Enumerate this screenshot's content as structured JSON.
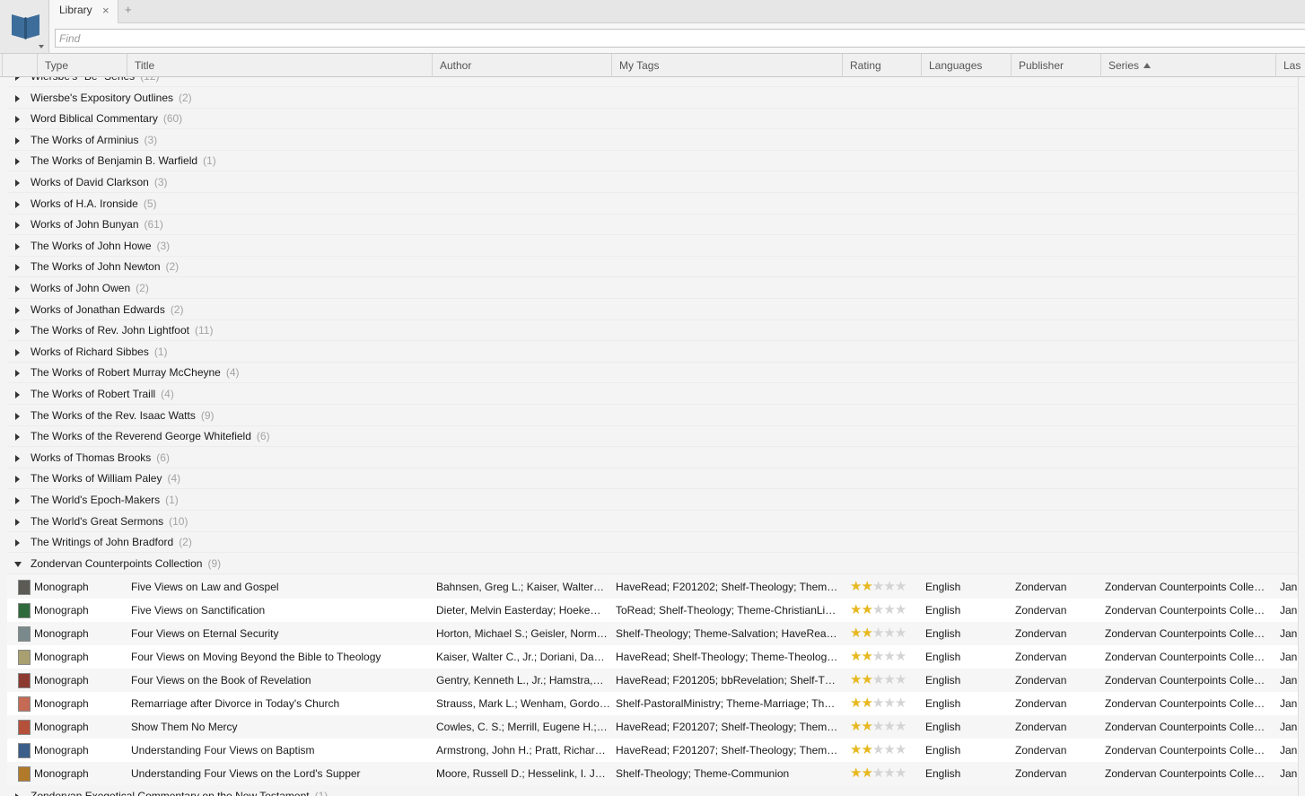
{
  "app": {
    "logo_icon": "library-book-icon",
    "tab_label": "Library",
    "tab_close": "×",
    "new_tab": "+",
    "find_placeholder": "Find"
  },
  "columns": [
    {
      "key": "type",
      "label": "Type"
    },
    {
      "key": "title",
      "label": "Title"
    },
    {
      "key": "author",
      "label": "Author"
    },
    {
      "key": "tags",
      "label": "My Tags"
    },
    {
      "key": "rating",
      "label": "Rating"
    },
    {
      "key": "languages",
      "label": "Languages"
    },
    {
      "key": "publisher",
      "label": "Publisher"
    },
    {
      "key": "series",
      "label": "Series"
    },
    {
      "key": "last",
      "label": "Las"
    }
  ],
  "sort": {
    "column": "series",
    "direction": "ascending"
  },
  "groups": [
    {
      "name": "Wiersbe's \"Be\" Series",
      "count": "(12)"
    },
    {
      "name": "Wiersbe's Expository Outlines",
      "count": "(2)"
    },
    {
      "name": "Word Biblical Commentary",
      "count": "(60)"
    },
    {
      "name": "The Works of Arminius",
      "count": "(3)"
    },
    {
      "name": "The Works of Benjamin B. Warfield",
      "count": "(1)"
    },
    {
      "name": "Works of David Clarkson",
      "count": "(3)"
    },
    {
      "name": "Works of H.A. Ironside",
      "count": "(5)"
    },
    {
      "name": "Works of John Bunyan",
      "count": "(61)"
    },
    {
      "name": "The Works of John Howe",
      "count": "(3)"
    },
    {
      "name": "The Works of John Newton",
      "count": "(2)"
    },
    {
      "name": "Works of John Owen",
      "count": "(2)"
    },
    {
      "name": "Works of Jonathan Edwards",
      "count": "(2)"
    },
    {
      "name": "The Works of Rev. John Lightfoot",
      "count": "(11)"
    },
    {
      "name": "Works of Richard Sibbes",
      "count": "(1)"
    },
    {
      "name": "The Works of Robert Murray McCheyne",
      "count": "(4)"
    },
    {
      "name": "The Works of Robert Traill",
      "count": "(4)"
    },
    {
      "name": "The Works of the Rev. Isaac Watts",
      "count": "(9)"
    },
    {
      "name": "The Works of the Reverend George Whitefield",
      "count": "(6)"
    },
    {
      "name": "Works of Thomas Brooks",
      "count": "(6)"
    },
    {
      "name": "The Works of William Paley",
      "count": "(4)"
    },
    {
      "name": "The World's Epoch-Makers",
      "count": "(1)"
    },
    {
      "name": "The World's Great Sermons",
      "count": "(10)"
    },
    {
      "name": "The Writings of John Bradford",
      "count": "(2)"
    }
  ],
  "expanded_group": {
    "name": "Zondervan Counterpoints Collection",
    "count": "(9)",
    "books": [
      {
        "type": "Monograph",
        "title": "Five Views on Law and Gospel",
        "author": "Bahnsen, Greg L.; Kaiser, Walter…",
        "tags": "HaveRead; F201202; Shelf-Theology; Them…",
        "rating": 2,
        "language": "English",
        "publisher": "Zondervan",
        "series": "Zondervan Counterpoints Colle…",
        "last": "Jan",
        "thumb_color": "#5b5a55"
      },
      {
        "type": "Monograph",
        "title": "Five Views on Sanctification",
        "author": "Dieter, Melvin Easterday; Hoeke…",
        "tags": "ToRead; Shelf-Theology; Theme-ChristianLi…",
        "rating": 2,
        "language": "English",
        "publisher": "Zondervan",
        "series": "Zondervan Counterpoints Colle…",
        "last": "Jan",
        "thumb_color": "#2f6a3c"
      },
      {
        "type": "Monograph",
        "title": "Four Views on Eternal Security",
        "author": "Horton, Michael S.; Geisler, Norm…",
        "tags": "Shelf-Theology; Theme-Salvation; HaveRea…",
        "rating": 2,
        "language": "English",
        "publisher": "Zondervan",
        "series": "Zondervan Counterpoints Colle…",
        "last": "Jan",
        "thumb_color": "#7a8a8c"
      },
      {
        "type": "Monograph",
        "title": "Four Views on Moving Beyond the Bible to Theology",
        "author": "Kaiser, Walter C., Jr.; Doriani, Da…",
        "tags": "HaveRead; Shelf-Theology; Theme-Theolog…",
        "rating": 2,
        "language": "English",
        "publisher": "Zondervan",
        "series": "Zondervan Counterpoints Colle…",
        "last": "Jan",
        "thumb_color": "#a8a070"
      },
      {
        "type": "Monograph",
        "title": "Four Views on the Book of Revelation",
        "author": "Gentry, Kenneth L., Jr.; Hamstra,…",
        "tags": "HaveRead; F201205; bbRevelation; Shelf-Th…",
        "rating": 2,
        "language": "English",
        "publisher": "Zondervan",
        "series": "Zondervan Counterpoints Colle…",
        "last": "Jan",
        "thumb_color": "#8c3a30"
      },
      {
        "type": "Monograph",
        "title": "Remarriage after Divorce in Today's Church",
        "author": "Strauss, Mark L.; Wenham, Gordo…",
        "tags": "Shelf-PastoralMinistry; Theme-Marriage; Th…",
        "rating": 2,
        "language": "English",
        "publisher": "Zondervan",
        "series": "Zondervan Counterpoints Colle…",
        "last": "Jan",
        "thumb_color": "#c46a55"
      },
      {
        "type": "Monograph",
        "title": "Show Them No Mercy",
        "author": "Cowles, C. S.; Merrill, Eugene H.;…",
        "tags": "HaveRead; F201207; Shelf-Theology; Them…",
        "rating": 2,
        "language": "English",
        "publisher": "Zondervan",
        "series": "Zondervan Counterpoints Colle…",
        "last": "Jan",
        "thumb_color": "#b5503a"
      },
      {
        "type": "Monograph",
        "title": "Understanding Four Views on Baptism",
        "author": "Armstrong, John H.; Pratt, Richar…",
        "tags": "HaveRead; F201207; Shelf-Theology; Them…",
        "rating": 2,
        "language": "English",
        "publisher": "Zondervan",
        "series": "Zondervan Counterpoints Colle…",
        "last": "Jan",
        "thumb_color": "#3b5f8a"
      },
      {
        "type": "Monograph",
        "title": "Understanding Four Views on the Lord's Supper",
        "author": "Moore, Russell D.; Hesselink, I. Jo…",
        "tags": "Shelf-Theology; Theme-Communion",
        "rating": 2,
        "language": "English",
        "publisher": "Zondervan",
        "series": "Zondervan Counterpoints Colle…",
        "last": "Jan",
        "thumb_color": "#b07a2a"
      }
    ]
  },
  "next_group": {
    "name": "Zondervan Exegetical Commentary on the New Testament",
    "count": "(1)"
  },
  "rating_max": 5,
  "colors": {
    "star_on": "#e7b820",
    "star_off": "#d4d4d4",
    "count_text": "#a3a3a3"
  }
}
